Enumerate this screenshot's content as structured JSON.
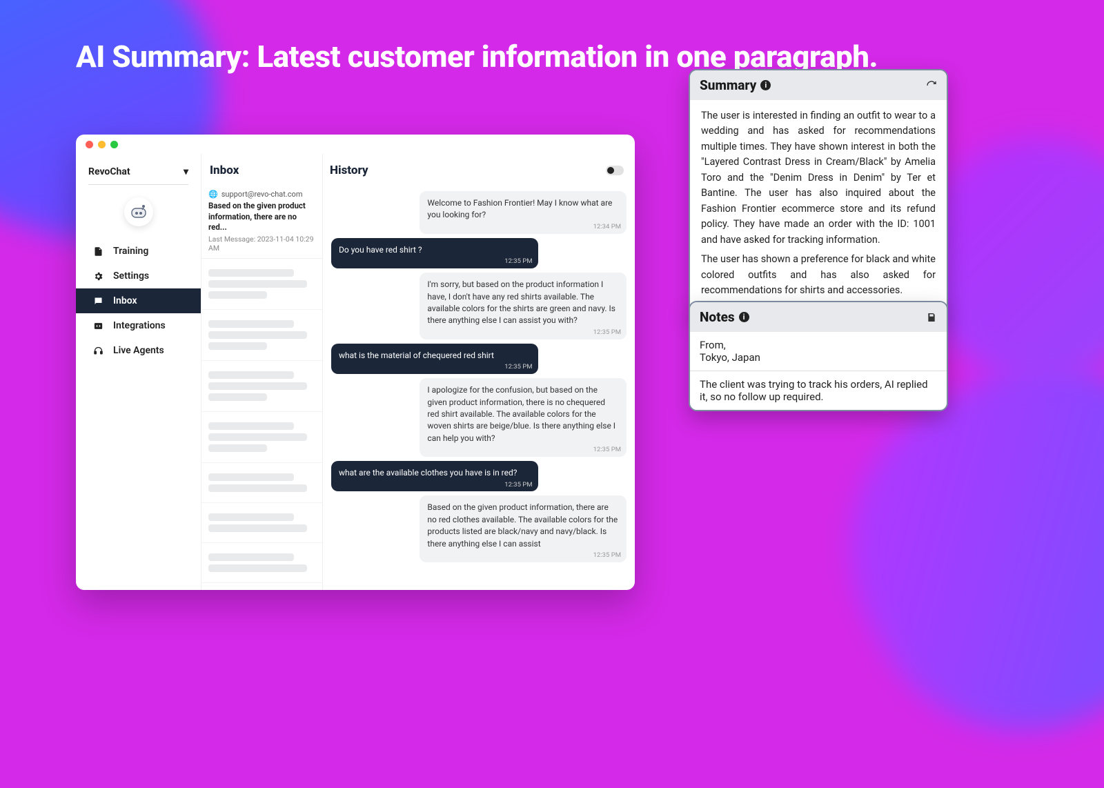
{
  "headline": "AI Summary: Latest customer information in one paragraph.",
  "brand": "RevoChat",
  "nav": {
    "training": "Training",
    "settings": "Settings",
    "inbox": "Inbox",
    "integrations": "Integrations",
    "live_agents": "Live Agents"
  },
  "inbox": {
    "title": "Inbox",
    "selected": {
      "from": "support@revo-chat.com",
      "excerpt": "Based on the given product information, there are no red...",
      "meta": "Last Message: 2023-11-04 10:29 AM"
    }
  },
  "history": {
    "title": "History",
    "messages": [
      {
        "role": "bot",
        "text": "Welcome to Fashion Frontier! May I know what are you looking for?",
        "time": "12:34 PM"
      },
      {
        "role": "user",
        "text": "Do you have red shirt ?",
        "time": "12:35 PM"
      },
      {
        "role": "bot",
        "text": "I'm sorry, but based on the product information I have, I don't have any red shirts available. The available colors for the shirts are green and navy. Is there anything else I can assist you with?",
        "time": "12:35 PM"
      },
      {
        "role": "user",
        "text": "what is the material of chequered red shirt",
        "time": "12:35 PM"
      },
      {
        "role": "bot",
        "text": "I apologize for the confusion, but based on the given product information, there is no chequered red shirt available. The available colors for the woven shirts are beige/blue. Is there anything else I can help you with?",
        "time": "12:35 PM"
      },
      {
        "role": "user",
        "text": "what are the available clothes you have is in red?",
        "time": "12:35 PM"
      },
      {
        "role": "bot",
        "text": "Based on the given product information, there are no red clothes available. The available colors for the products listed are black/navy and navy/black. Is there anything else I can assist",
        "time": "12:35 PM"
      }
    ]
  },
  "summary": {
    "title": "Summary",
    "p1": "The user is interested in finding an outfit to wear to a wedding and has asked for recommendations multiple times. They have shown interest in both the \"Layered Contrast Dress in Cream/Black\" by Amelia Toro and the \"Denim Dress in Denim\" by Ter et Bantine. The user has also inquired about the Fashion Frontier ecommerce store and its refund policy. They have made an order with the ID: 1001 and have asked for tracking information.",
    "p2": "The user has shown a preference for black and white colored outfits and has also asked for recommendations for shirts and accessories."
  },
  "notes": {
    "title": "Notes",
    "from_label": "From,",
    "from_value": "Tokyo, Japan",
    "body": "The client was trying to track his orders, AI replied it, so no follow up required."
  }
}
